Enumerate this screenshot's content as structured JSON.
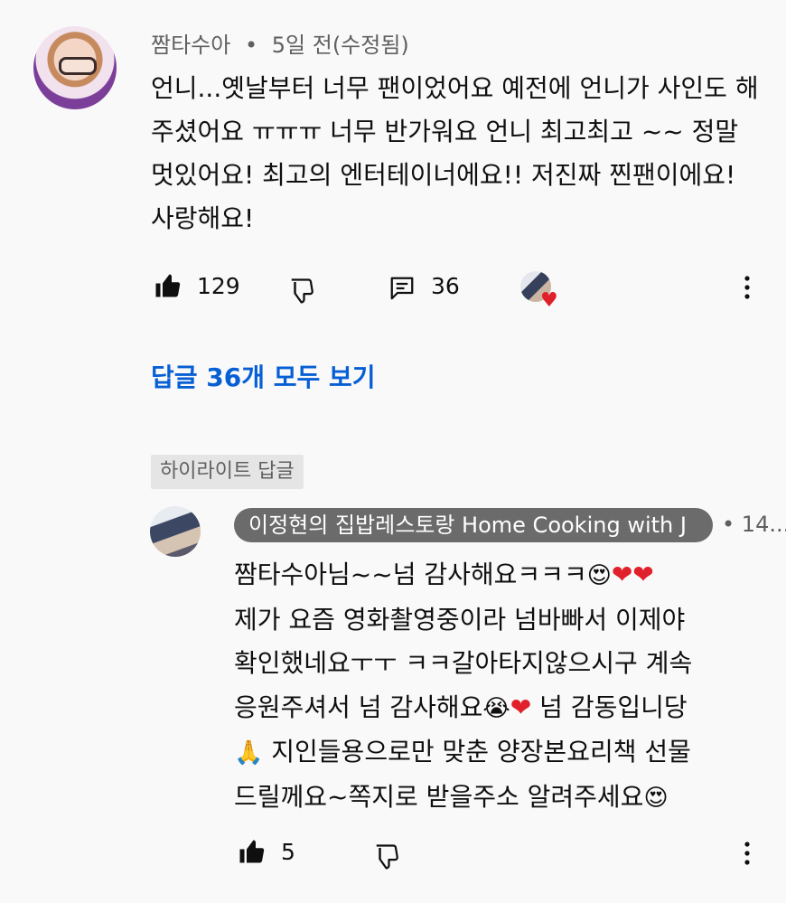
{
  "comment": {
    "author": "짬타수아",
    "separator": "•",
    "time": "5일 전(수정됨)",
    "text": "언니...옛날부터 너무 팬이었어요 예전에 언니가 사인도 해주셨어요 ㅠㅠㅠ 너무 반가워요 언니 최고최고 ~~ 정말 멋있어요! 최고의 엔터테이너에요!! 저진짜 찐팬이에요! 사랑해요!",
    "likes": "129",
    "reply_count": "36",
    "heart_icon": "heart-badge"
  },
  "view_replies": "답글 36개 모두 보기",
  "highlight_label": "하이라이트 답글",
  "reply": {
    "author": "이정현의 집밥레스토랑 Home Cooking with J",
    "separator": "•",
    "time": "14...",
    "line1": "짬타수아님~~넘 감사해요ㅋㅋㅋ",
    "line2": "제가 요즘 영화촬영중이라 넘바빠서 이제야",
    "line3": "확인했네요ㅜㅜ  ㅋㅋ갈아타지않으시구 계속",
    "line4a": "응원주셔서 넘 감사해요",
    "line4b": " 넘 감동입니당",
    "line5": " 지인들용으로만 맞춘 양장본요리책 선물",
    "line6": "드릴께요~쪽지로 받을주소 알려주세요",
    "likes": "5"
  },
  "colors": {
    "link": "#065fd4",
    "secondary_text": "#606060",
    "heart": "#e0202b",
    "chip_bg": "#e5e5e5",
    "author_chip_bg": "#6b6b6b"
  }
}
